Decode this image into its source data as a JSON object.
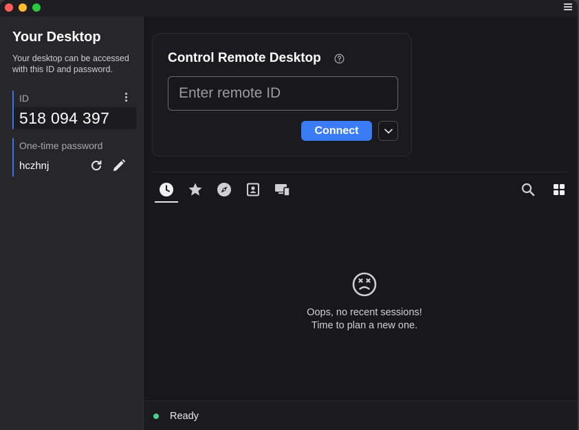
{
  "window": {
    "traffic_lights": [
      "close",
      "minimize",
      "zoom"
    ],
    "menu_icon": "hamburger-menu-icon"
  },
  "sidebar": {
    "title": "Your Desktop",
    "description": "Your desktop can be accessed with this ID and password.",
    "id_label": "ID",
    "id_value": "518 094 397",
    "password_label": "One-time password",
    "password_value": "hczhnj"
  },
  "remote": {
    "title": "Control Remote Desktop",
    "input_placeholder": "Enter remote ID",
    "input_value": "",
    "connect_label": "Connect"
  },
  "tabs": [
    {
      "name": "recent-sessions",
      "icon": "clock-icon",
      "active": true
    },
    {
      "name": "favorites",
      "icon": "star-icon",
      "active": false
    },
    {
      "name": "discovered",
      "icon": "compass-icon",
      "active": false
    },
    {
      "name": "address-book",
      "icon": "contact-card-icon",
      "active": false
    },
    {
      "name": "devices",
      "icon": "devices-icon",
      "active": false
    }
  ],
  "empty_state": {
    "line1": "Oops, no recent sessions!",
    "line2": "Time to plan a new one."
  },
  "status": {
    "text": "Ready",
    "color": "#4fcf8f"
  },
  "colors": {
    "accent": "#3a7cf5",
    "background": "#18181c",
    "sidebar": "#26262b"
  }
}
